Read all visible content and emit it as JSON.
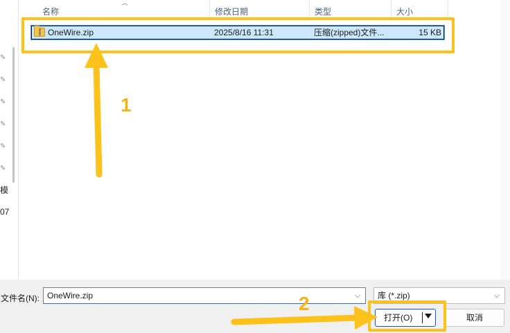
{
  "columns": {
    "name": "名称",
    "modified": "修改日期",
    "type": "类型",
    "size": "大小"
  },
  "file": {
    "name": "OneWire.zip",
    "modified": "2025/8/16 11:31",
    "type": "压缩(zipped)文件...",
    "size": "15 KB"
  },
  "left_nav": {
    "cut_text_1": "模",
    "cut_text_2": "07"
  },
  "bottom": {
    "filename_label": "文件名(N):",
    "filename_value": "OneWire.zip",
    "filter_value": "库 (*.zip)",
    "open_label": "打开(O)",
    "cancel_label": "取消"
  },
  "annotations": {
    "step1": "1",
    "step2": "2",
    "color": "#fcc21b"
  },
  "colors": {
    "selection_bg": "#cce8ff",
    "selection_border": "#3399ff",
    "primary_border": "#0b5cd6"
  }
}
